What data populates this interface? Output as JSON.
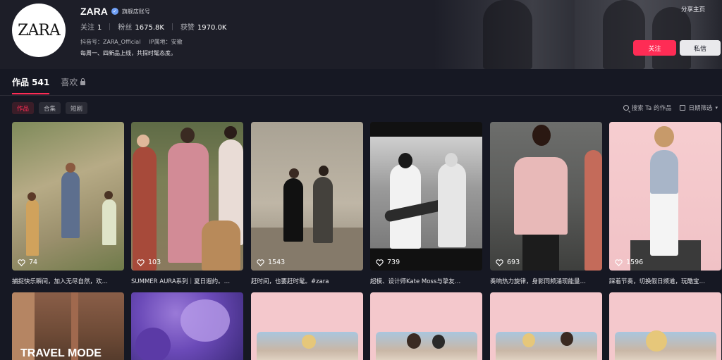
{
  "profile": {
    "avatar_text": "ZARA",
    "name": "ZARA",
    "verified_label": "旗舰店账号",
    "following_label": "关注",
    "following_count": "1",
    "followers_label": "粉丝",
    "followers_count": "1675.8K",
    "likes_label": "获赞",
    "likes_count": "1970.0K",
    "douyin_id": "抖音号：ZARA_Official",
    "ip_location": "IP属地：安徽",
    "bio": "每周一、四新品上线，共探时髦态度。",
    "share_label": "分享主页",
    "follow_button": "关注",
    "message_button": "私信"
  },
  "tabs": [
    {
      "label": "作品 541",
      "active": true
    },
    {
      "label": "喜欢",
      "active": false,
      "locked": true
    }
  ],
  "subtabs": [
    {
      "label": "作品",
      "active": true
    },
    {
      "label": "合集",
      "active": false
    },
    {
      "label": "短剧",
      "active": false
    }
  ],
  "tools": {
    "search_label": "搜索 Ta 的作品",
    "date_filter_label": "日期筛选"
  },
  "videos": [
    {
      "likes": "74",
      "caption": "捕捉快乐瞬间，加入无尽自然，欢…"
    },
    {
      "likes": "103",
      "caption": "SUMMER AURA系列｜夏日遐约。…"
    },
    {
      "likes": "1543",
      "caption": "赶时间，也要赶时髦。#zara"
    },
    {
      "likes": "739",
      "caption": "超模、设计师Kate Moss与挚友…"
    },
    {
      "likes": "693",
      "caption": "奏响热力旋律，身影同频涌现能量…"
    },
    {
      "likes": "1596",
      "caption": "踩着节奏，切换假日频道，玩酷宝…"
    }
  ],
  "row2": [
    {
      "overlay_text": "TRAVEL MODE"
    },
    {
      "overlay_text": ""
    },
    {
      "overlay_text": ""
    },
    {
      "overlay_text": ""
    },
    {
      "overlay_text": ""
    },
    {
      "overlay_text": ""
    }
  ],
  "colors": {
    "accent": "#fe2c55",
    "background": "#161823"
  }
}
